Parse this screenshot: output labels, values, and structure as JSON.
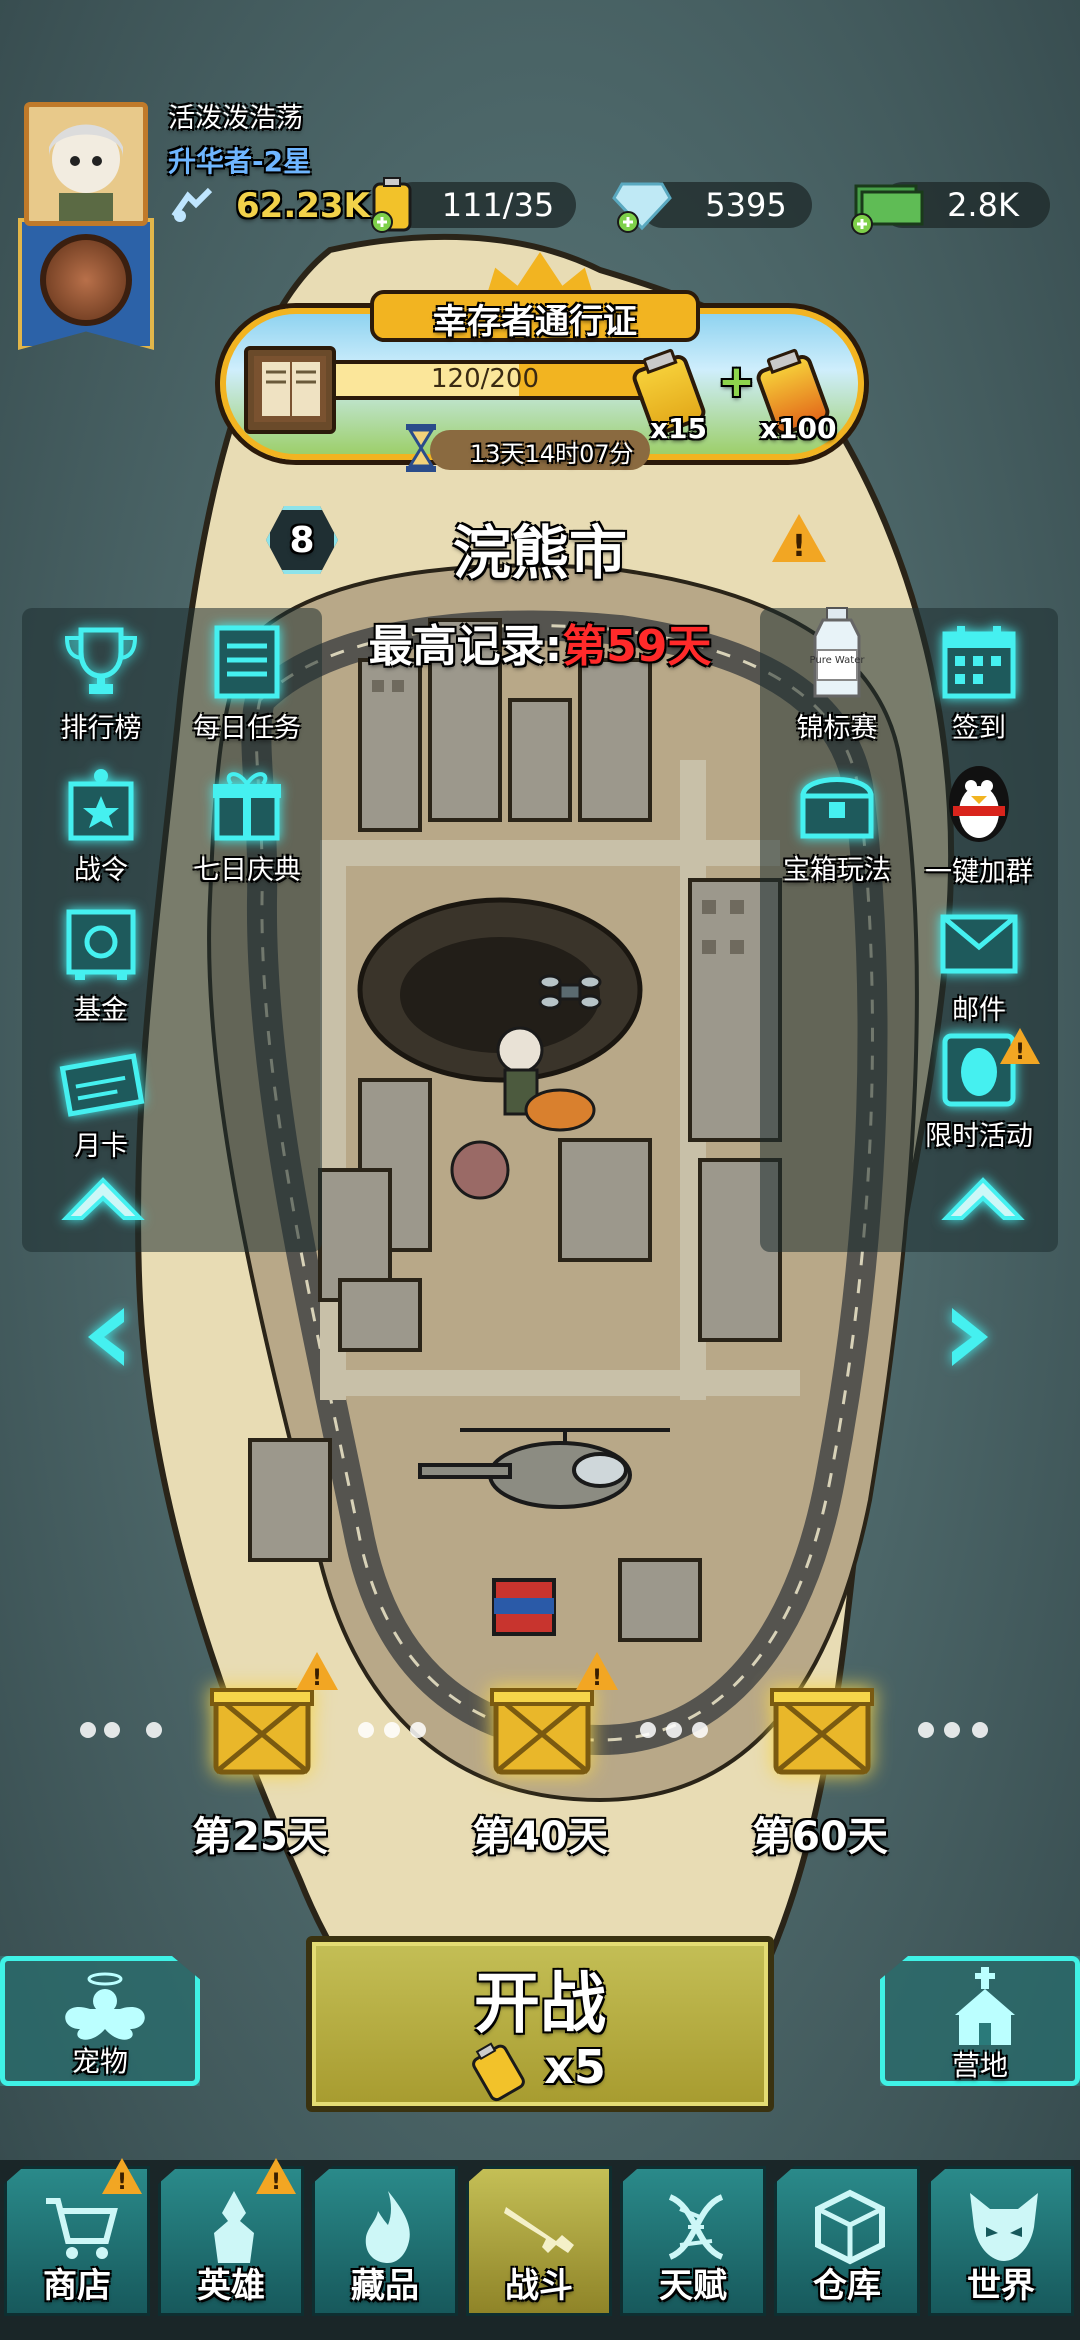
{
  "player": {
    "name": "活泼泼浩荡",
    "rank": "升华者-2星"
  },
  "resources": {
    "power": "62.23K",
    "energy": "111/35",
    "diamonds": "5395",
    "cash": "2.8K"
  },
  "pass": {
    "title": "幸存者通行证",
    "progress_text": "120/200",
    "progress_fraction": 0.6,
    "timer": "13天14时07分",
    "reward1_mult": "x15",
    "reward2_mult": "x100"
  },
  "city": {
    "level": "8",
    "name": "浣熊市",
    "record_prefix": "最高记录:",
    "record_value": "第59天"
  },
  "left_features": [
    {
      "label": "排行榜",
      "icon": "trophy-icon"
    },
    {
      "label": "每日任务",
      "icon": "task-list-icon"
    },
    {
      "label": "战令",
      "icon": "battle-pass-icon"
    },
    {
      "label": "七日庆典",
      "icon": "gift-icon"
    },
    {
      "label": "基金",
      "icon": "safe-icon"
    },
    {
      "label": "月卡",
      "icon": "ticket-icon"
    }
  ],
  "right_features": [
    {
      "label": "锦标赛",
      "icon": "water-bottle-icon"
    },
    {
      "label": "签到",
      "icon": "calendar-icon"
    },
    {
      "label": "宝箱玩法",
      "icon": "treasure-chest-icon"
    },
    {
      "label": "一键加群",
      "icon": "penguin-icon"
    },
    {
      "label": "邮件",
      "icon": "mail-icon"
    },
    {
      "label": "限时活动",
      "icon": "egg-icon"
    }
  ],
  "bottle_text": "Pure Water",
  "milestones": [
    {
      "label": "第25天"
    },
    {
      "label": "第40天"
    },
    {
      "label": "第60天"
    }
  ],
  "actions": {
    "start_label": "开战",
    "start_cost": "x5",
    "pet_label": "宠物",
    "camp_label": "营地"
  },
  "tabs": [
    {
      "label": "商店",
      "icon": "cart-icon",
      "warn": true
    },
    {
      "label": "英雄",
      "icon": "hero-icon",
      "warn": true
    },
    {
      "label": "藏品",
      "icon": "flame-icon",
      "warn": false
    },
    {
      "label": "战斗",
      "icon": "rifle-icon",
      "warn": false,
      "active": true
    },
    {
      "label": "天赋",
      "icon": "dna-icon",
      "warn": false
    },
    {
      "label": "仓库",
      "icon": "crate-icon",
      "warn": false
    },
    {
      "label": "世界",
      "icon": "demon-icon",
      "warn": false
    }
  ],
  "colors": {
    "accent_cyan": "#3ff2e6",
    "pass_gold": "#f2b421",
    "record_red": "#ff2a2a",
    "rank_blue": "#6fb6ff"
  }
}
